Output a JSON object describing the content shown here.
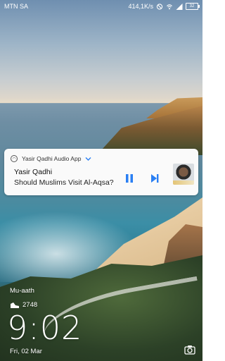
{
  "status_bar": {
    "carrier": "MTN SA",
    "network_speed": "414,1K/s",
    "battery_level": "32"
  },
  "notification": {
    "app_name": "Yasir Qadhi Audio App",
    "title": "Yasir Qadhi",
    "subtitle": "Should Muslims Visit Al-Aqsa?",
    "accent_color": "#2a7ff3",
    "icons": [
      "app-icon",
      "chevron-down-icon",
      "pause-icon",
      "skip-next-icon",
      "album-thumbnail"
    ]
  },
  "lock_screen": {
    "label": "Mu-aath",
    "steps": "2748",
    "time": "9:02",
    "date": "Fri, 02 Mar",
    "icons": [
      "shoe-icon",
      "camera-icon"
    ]
  }
}
